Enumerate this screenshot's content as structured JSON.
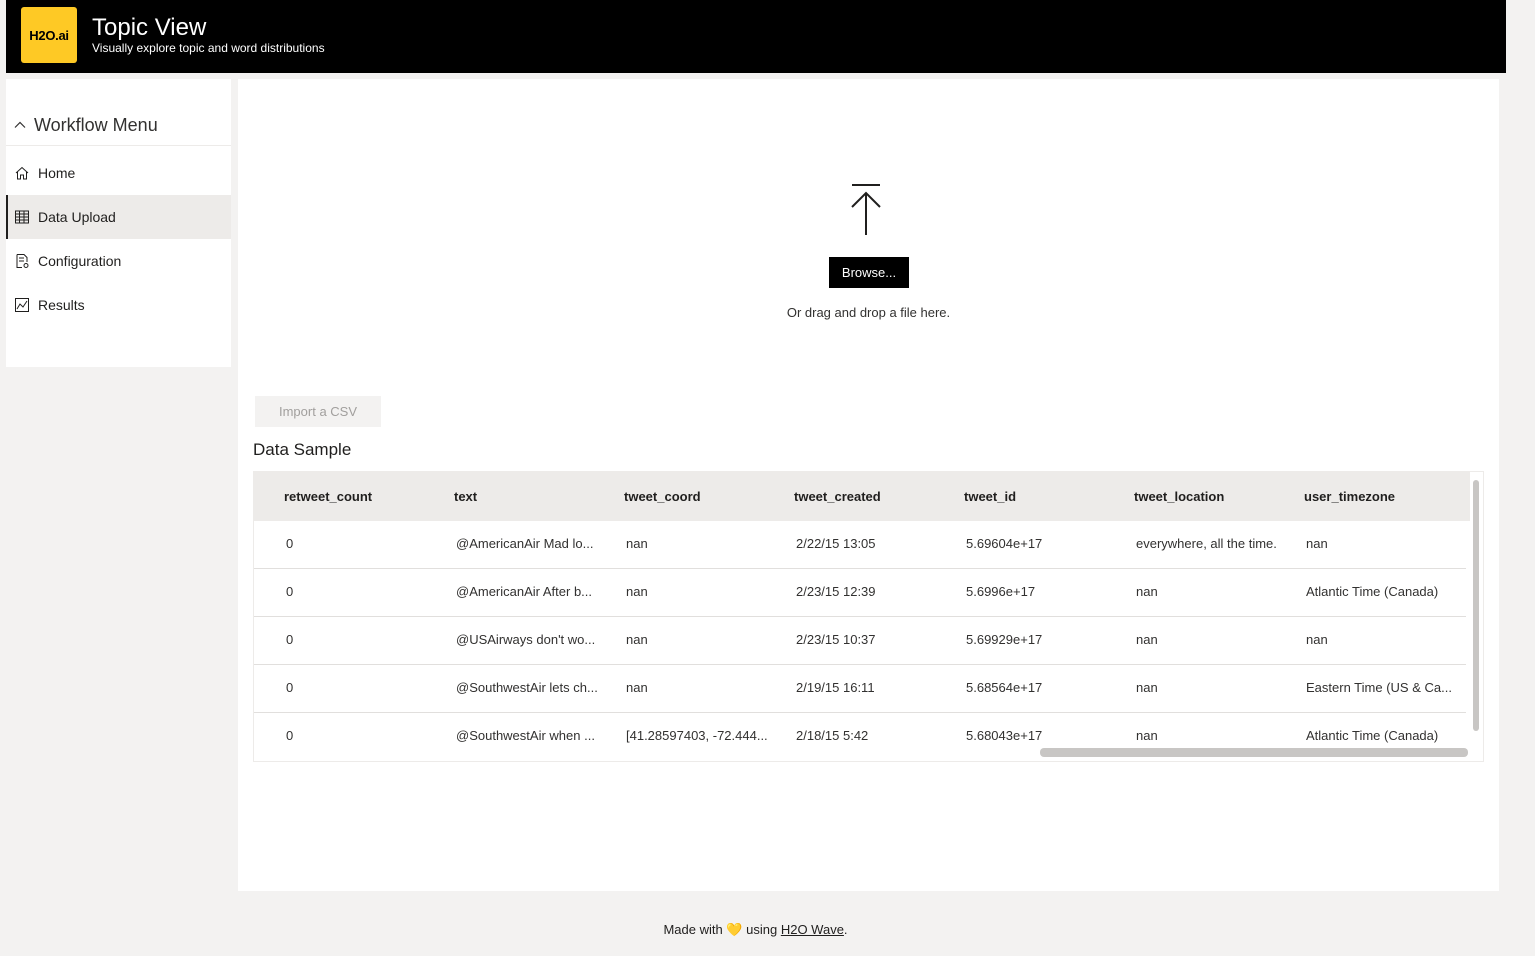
{
  "header": {
    "logo_text": "H2O.ai",
    "title": "Topic View",
    "subtitle": "Visually explore topic and word distributions"
  },
  "sidebar": {
    "menu_title": "Workflow Menu",
    "items": [
      {
        "label": "Home",
        "icon": "home-icon"
      },
      {
        "label": "Data Upload",
        "icon": "table-icon",
        "active": true
      },
      {
        "label": "Configuration",
        "icon": "configuration-icon"
      },
      {
        "label": "Results",
        "icon": "chart-icon"
      }
    ]
  },
  "upload": {
    "browse_label": "Browse...",
    "drag_text": "Or drag and drop a file here.",
    "import_label": "Import a CSV"
  },
  "data_sample": {
    "title": "Data Sample",
    "columns": [
      "retweet_count",
      "text",
      "tweet_coord",
      "tweet_created",
      "tweet_id",
      "tweet_location",
      "user_timezone"
    ],
    "rows": [
      [
        "0",
        "@AmericanAir Mad lo...",
        "nan",
        "2/22/15 13:05",
        "5.69604e+17",
        "everywhere, all the time.",
        "nan"
      ],
      [
        "0",
        "@AmericanAir After b...",
        "nan",
        "2/23/15 12:39",
        "5.6996e+17",
        "nan",
        "Atlantic Time (Canada)"
      ],
      [
        "0",
        "@USAirways don't wo...",
        "nan",
        "2/23/15 10:37",
        "5.69929e+17",
        "nan",
        "nan"
      ],
      [
        "0",
        "@SouthwestAir lets ch...",
        "nan",
        "2/19/15 16:11",
        "5.68564e+17",
        "nan",
        "Eastern Time (US & Ca..."
      ],
      [
        "0",
        "@SouthwestAir when ...",
        "[41.28597403, -72.444...",
        "2/18/15 5:42",
        "5.68043e+17",
        "nan",
        "Atlantic Time (Canada)"
      ]
    ]
  },
  "footer": {
    "prefix": "Made with",
    "heart": "💛",
    "using": "using",
    "link_text": "H2O Wave",
    "suffix": "."
  },
  "colors": {
    "brand": "#fec925",
    "header_bg": "#000000",
    "active_nav_bg": "#edebe9"
  }
}
